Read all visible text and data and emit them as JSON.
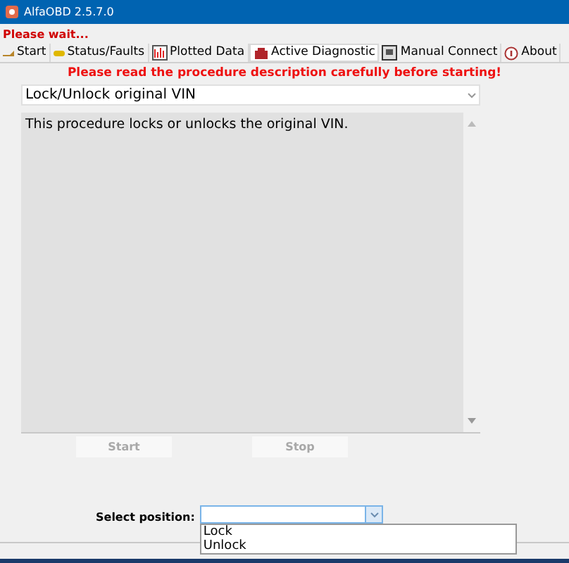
{
  "window": {
    "title": "AlfaOBD 2.5.7.0"
  },
  "status": "Please wait...",
  "tabs": [
    {
      "label": "Start",
      "selected": false
    },
    {
      "label": "Status/Faults",
      "selected": false
    },
    {
      "label": "Plotted Data",
      "selected": false
    },
    {
      "label": "Active Diagnostic",
      "selected": true
    },
    {
      "label": "Manual Connect",
      "selected": false
    },
    {
      "label": "About",
      "selected": false
    }
  ],
  "notice": "Please read the procedure description carefully before starting!",
  "procedure": {
    "value": "Lock/Unlock original VIN"
  },
  "description": "This procedure locks or unlocks the original VIN.",
  "buttons": [
    {
      "label": "Start",
      "disabled": true
    },
    {
      "label": "Stop",
      "disabled": true
    }
  ],
  "position": {
    "label": "Select position:",
    "expanded": true,
    "options": [
      {
        "label": "Lock",
        "selected": false
      },
      {
        "label": "Unlock",
        "selected": false
      }
    ]
  }
}
